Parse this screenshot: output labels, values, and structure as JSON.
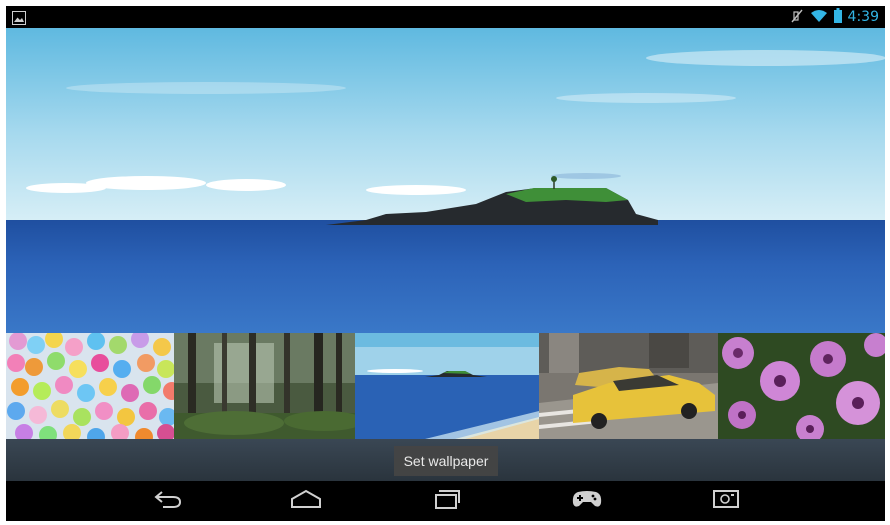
{
  "status_bar": {
    "time": "4:39",
    "icons": [
      "gallery-icon",
      "mute-icon",
      "wifi-icon",
      "battery-icon"
    ],
    "time_color": "#33b5e5"
  },
  "wallpaper_picker": {
    "thumbnails": [
      {
        "name": "balloons"
      },
      {
        "name": "forest"
      },
      {
        "name": "island-sea",
        "selected": true
      },
      {
        "name": "taxi"
      },
      {
        "name": "purple-flowers"
      }
    ]
  },
  "action_bar": {
    "set_wallpaper_label": "Set wallpaper"
  },
  "nav_bar": {
    "buttons": [
      "back-icon",
      "home-icon",
      "recent-apps-icon",
      "games-icon",
      "screenshot-icon"
    ]
  }
}
